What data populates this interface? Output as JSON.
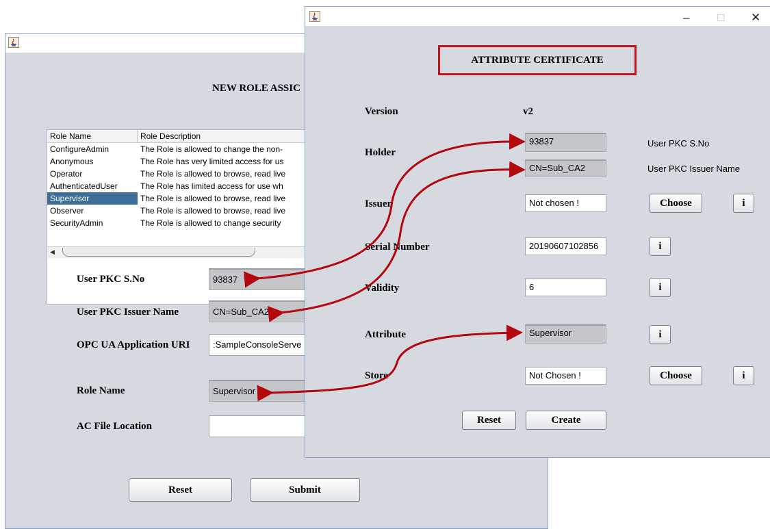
{
  "back_window": {
    "title": "NEW ROLE ASSIC",
    "table": {
      "columns": [
        "Role Name",
        "Role Description"
      ],
      "rows": [
        {
          "name": "ConfigureAdmin",
          "desc": "The Role is allowed to change the non-"
        },
        {
          "name": "Anonymous",
          "desc": "The Role has very limited access for us"
        },
        {
          "name": "Operator",
          "desc": "The Role is allowed to browse, read live"
        },
        {
          "name": "AuthenticatedUser",
          "desc": "The Role has limited access for use wh"
        },
        {
          "name": "Supervisor",
          "desc": "The Role is allowed to browse, read live"
        },
        {
          "name": "Observer",
          "desc": "The Role is allowed to browse, read live"
        },
        {
          "name": "SecurityAdmin",
          "desc": "The Role is allowed to change security"
        }
      ],
      "selected_row": "Supervisor"
    },
    "form": {
      "user_pkc_sno_label": "User PKC S.No",
      "user_pkc_sno_value": "93837",
      "issuer_name_label": "User PKC Issuer Name",
      "issuer_name_value": "CN=Sub_CA2",
      "app_uri_label": "OPC UA Application URI",
      "app_uri_value": ":SampleConsoleServe",
      "role_name_label": "Role Name",
      "role_name_value": "Supervisor",
      "ac_file_label": "AC File Location",
      "ac_file_value": ""
    },
    "buttons": {
      "reset": "Reset",
      "submit": "Submit"
    }
  },
  "front_window": {
    "title": "ATTRIBUTE CERTIFICATE",
    "version_label": "Version",
    "version_value": "v2",
    "holder_label": "Holder",
    "holder_sno_value": "93837",
    "holder_sno_caption": "User PKC S.No",
    "holder_issuer_value": "CN=Sub_CA2",
    "holder_issuer_caption": "User PKC Issuer Name",
    "issuer_label": "Issuer",
    "issuer_value": "Not chosen !",
    "serial_label": "Serial Number",
    "serial_value": "20190607102856",
    "validity_label": "Validity",
    "validity_value": "6",
    "attribute_label": "Attribute",
    "attribute_value": "Supervisor",
    "store_label": "Store",
    "store_value": "Not Chosen !",
    "choose_label": "Choose",
    "info_label": "i",
    "reset_label": "Reset",
    "create_label": "Create",
    "controls": {
      "minimize": "–",
      "maximize": "☐",
      "close": "✕"
    }
  },
  "colors": {
    "arrow": "#b3080d",
    "title_box": "#c0141b",
    "selection": "#3c6e98"
  }
}
